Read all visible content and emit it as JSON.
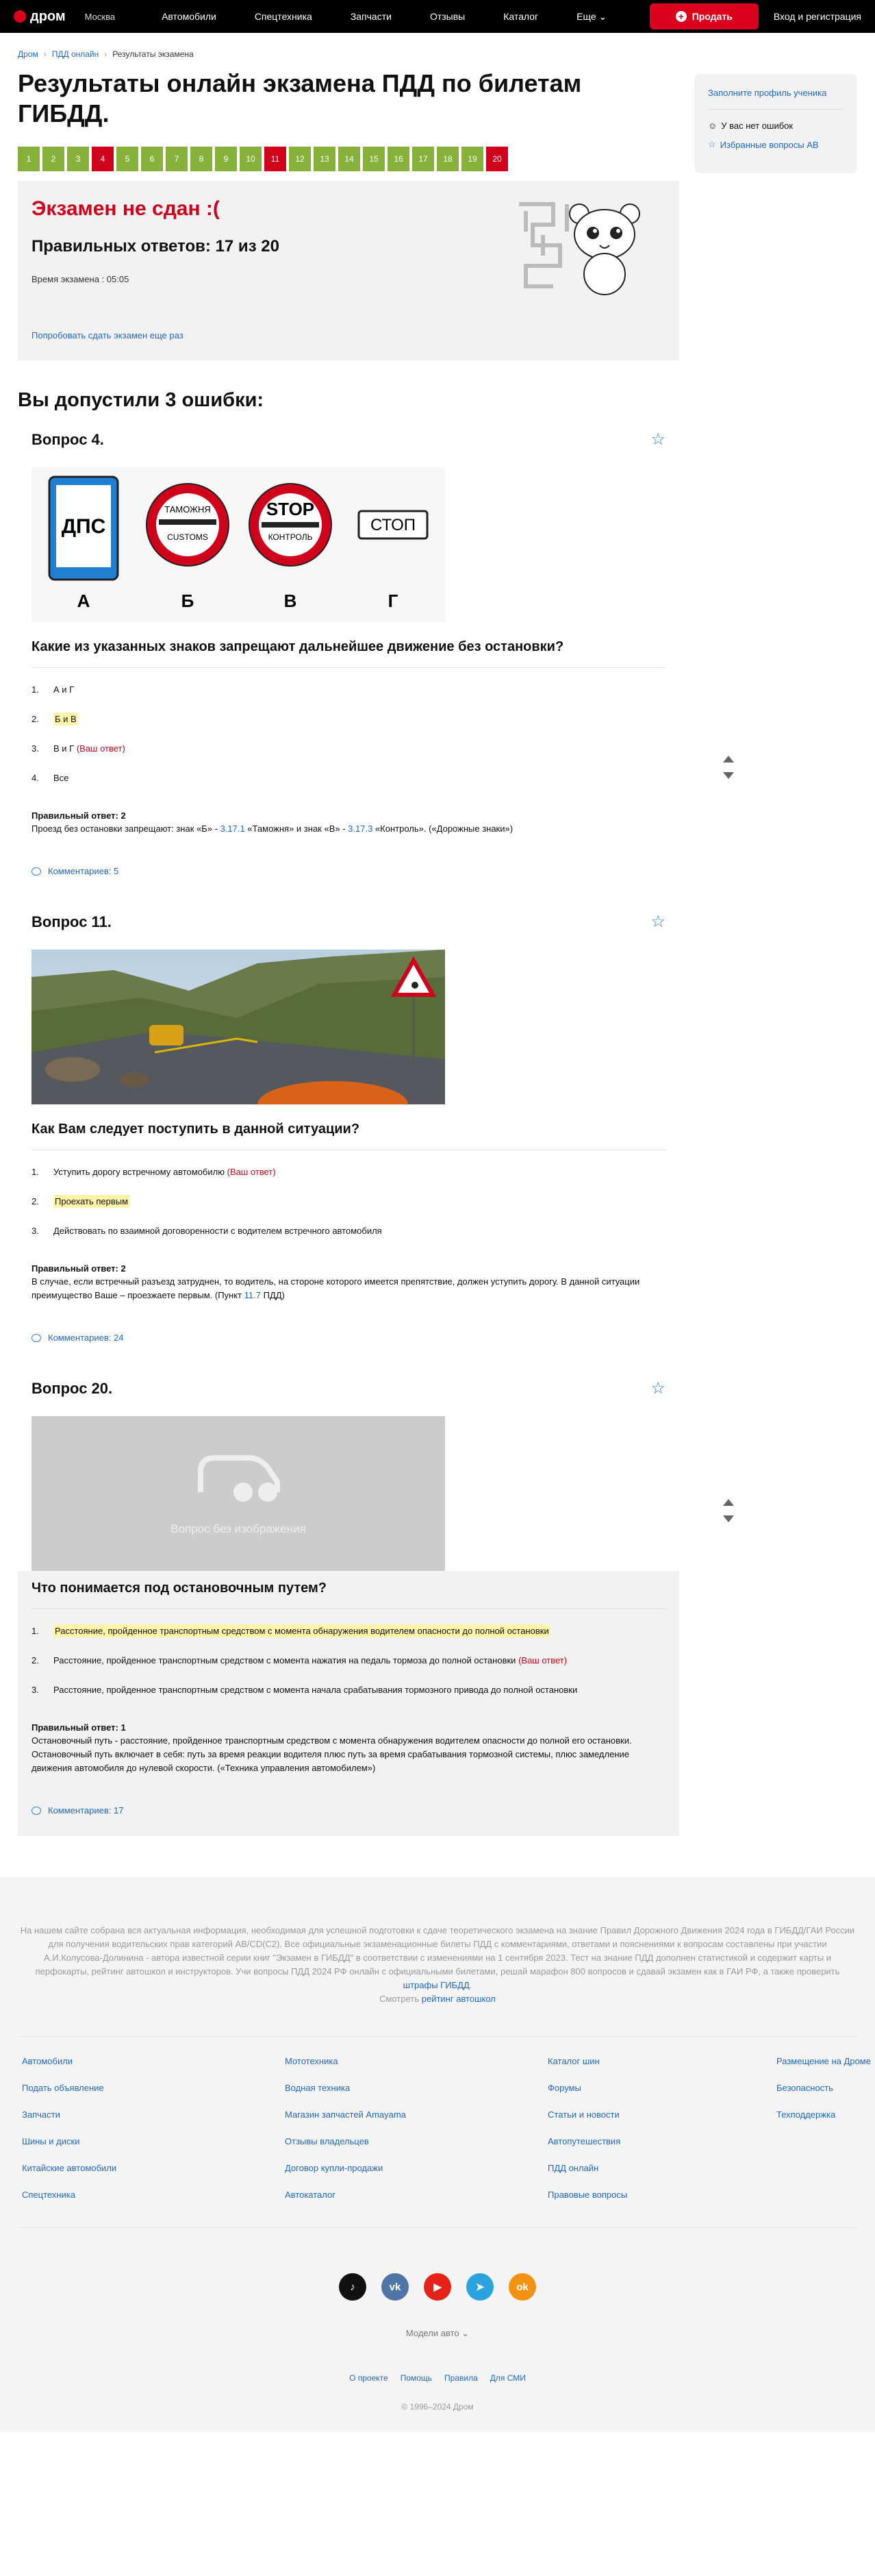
{
  "header": {
    "logo": "дром",
    "city": "Москва",
    "nav": [
      "Автомобили",
      "Спецтехника",
      "Запчасти",
      "Отзывы",
      "Каталог",
      "Еще"
    ],
    "sell": "Продать",
    "login": "Вход и регистрация"
  },
  "breadcrumbs": [
    "Дром",
    "ПДД онлайн",
    "Результаты экзамена"
  ],
  "title": "Результаты онлайн экзамена ПДД по билетам ГИБДД.",
  "pager": [
    {
      "n": "1",
      "s": "ok"
    },
    {
      "n": "2",
      "s": "ok"
    },
    {
      "n": "3",
      "s": "ok"
    },
    {
      "n": "4",
      "s": "bad"
    },
    {
      "n": "5",
      "s": "ok"
    },
    {
      "n": "6",
      "s": "ok"
    },
    {
      "n": "7",
      "s": "ok"
    },
    {
      "n": "8",
      "s": "ok"
    },
    {
      "n": "9",
      "s": "ok"
    },
    {
      "n": "10",
      "s": "ok"
    },
    {
      "n": "11",
      "s": "bad"
    },
    {
      "n": "12",
      "s": "ok"
    },
    {
      "n": "13",
      "s": "ok"
    },
    {
      "n": "14",
      "s": "ok"
    },
    {
      "n": "15",
      "s": "ok"
    },
    {
      "n": "16",
      "s": "ok"
    },
    {
      "n": "17",
      "s": "ok"
    },
    {
      "n": "18",
      "s": "ok"
    },
    {
      "n": "19",
      "s": "ok"
    },
    {
      "n": "20",
      "s": "bad"
    }
  ],
  "result": {
    "status": "Экзамен не сдан :(",
    "score": "Правильных ответов: 17 из 20",
    "time": "Время экзамена : 05:05",
    "retry": "Попробовать сдать экзамен еще раз"
  },
  "errors_title": "Вы допустили 3 ошибки:",
  "questions": [
    {
      "title": "Вопрос 4.",
      "signs": {
        "a": "А",
        "b": "Б",
        "v": "В",
        "g": "Г",
        "dps": "ДПС",
        "tam": "ТАМОЖНЯ",
        "customs": "CUSTOMS",
        "stop": "STOP",
        "control": "КОНТРОЛЬ",
        "stop_ru": "СТОП"
      },
      "text": "Какие из указанных знаков запрещают дальнейшее движение без остановки?",
      "answers": [
        {
          "num": "1.",
          "text": "А и Г",
          "correct": false,
          "yours": false
        },
        {
          "num": "2.",
          "text": "Б и В",
          "correct": true,
          "yours": false
        },
        {
          "num": "3.",
          "text": "В и Г",
          "correct": false,
          "yours": true
        },
        {
          "num": "4.",
          "text": "Все",
          "correct": false,
          "yours": false
        }
      ],
      "correct_label": "Правильный ответ: 2",
      "explain_parts": [
        "Проезд без остановки запрещают: знак «Б» - ",
        "3.17.1",
        " «Таможня» и знак «В» - ",
        "3.17.3",
        " «Контроль». («Дорожные знаки»)"
      ],
      "comments": "Комментариев: 5"
    },
    {
      "title": "Вопрос 11.",
      "text": "Как Вам следует поступить в данной ситуации?",
      "answers": [
        {
          "num": "1.",
          "text": "Уступить дорогу встречному автомобилю",
          "correct": false,
          "yours": true
        },
        {
          "num": "2.",
          "text": "Проехать первым",
          "correct": true,
          "yours": false
        },
        {
          "num": "3.",
          "text": "Действовать по взаимной договоренности с водителем встречного автомобиля",
          "correct": false,
          "yours": false
        }
      ],
      "correct_label": "Правильный ответ: 2",
      "explain_parts": [
        "В случае, если встречный разъезд затруднен, то водитель, на стороне которого имеется препятствие, должен уступить дорогу. В данной ситуации преимущество Ваше – проезжаете первым. (Пункт ",
        "11.7",
        " ПДД)"
      ],
      "comments": "Комментариев: 24"
    },
    {
      "title": "Вопрос 20.",
      "no_image": "Вопрос без изображения",
      "text": "Что понимается под остановочным путем?",
      "answers": [
        {
          "num": "1.",
          "text": "Расстояние, пройденное транспортным средством с момента обнаружения водителем опасности до полной остановки",
          "correct": true,
          "yours": false
        },
        {
          "num": "2.",
          "text": "Расстояние, пройденное транспортным средством с момента нажатия на педаль тормоза до полной остановки",
          "correct": false,
          "yours": true
        },
        {
          "num": "3.",
          "text": "Расстояние, пройденное транспортным средством с момента начала срабатывания тормозного привода до полной остановки",
          "correct": false,
          "yours": false
        }
      ],
      "correct_label": "Правильный ответ: 1",
      "explain_parts": [
        "Остановочный путь - расстояние, пройденное транспортным средством с момента обнаружения водителем опасности до полной его остановки. Остановочный путь включает в себя: путь за время реакции водителя плюс путь за время срабатывания тормозной системы, плюс замедление движения автомобиля до нулевой скорости. («Техника управления автомобилем»)"
      ],
      "comments": "Комментариев: 17"
    }
  ],
  "your_answer": "(Ваш ответ)",
  "sidebar": {
    "profile": "Заполните профиль ученика",
    "no_errors": "У вас нет ошибок",
    "favorites": "Избранные вопросы АВ"
  },
  "footer": {
    "seo": "На нашем сайте собрана вся актуальная информация, необходимая для успешной подготовки к сдаче теоретического экзамена на знание Правил Дорожного Движения 2024 года в ГИБДД/ГАИ России для получения водительских прав категорий AB/CD(C2). Все официальные экзаменационные билеты ПДД с комментариями, ответами и пояснениями к вопросам составлены при участии А.И.Колусова-Долинина - автора известной серии книг \"Экзамен в ГИБДД\" в соответствии с изменениями на 1 сентября 2023. Тест на знание ПДД дополнен статистикой и содержит карты и перфокарты, рейтинг автошкол и инструкторов. Учи вопросы ПДД 2024 РФ онлайн с официальными билетами, решай марафон 800 вопросов и сдавай экзамен как в ГАИ РФ, а также проверить",
    "seo_link1": "штрафы ГИБДД",
    "seo_tail": "Смотреть",
    "seo_link2": "рейтинг автошкол",
    "links": [
      "Автомобили",
      "Мототехника",
      "Каталог шин",
      "Размещение на Дроме",
      "Подать объявление",
      "Водная техника",
      "Форумы",
      "Безопасность",
      "Запчасти",
      "Магазин запчастей Amayama",
      "Статьи и новости",
      "Техподдержка",
      "Шины и диски",
      "Отзывы владельцев",
      "Автопутешествия",
      "",
      "Китайские автомобили",
      "Договор купли-продажи",
      "ПДД онлайн",
      "",
      "Спецтехника",
      "Автокаталог",
      "Правовые вопросы",
      ""
    ],
    "models": "Модели авто",
    "bottom": [
      "О проекте",
      "Помощь",
      "Правила",
      "Для СМИ"
    ],
    "copyright": "© 1996–2024 Дром"
  }
}
